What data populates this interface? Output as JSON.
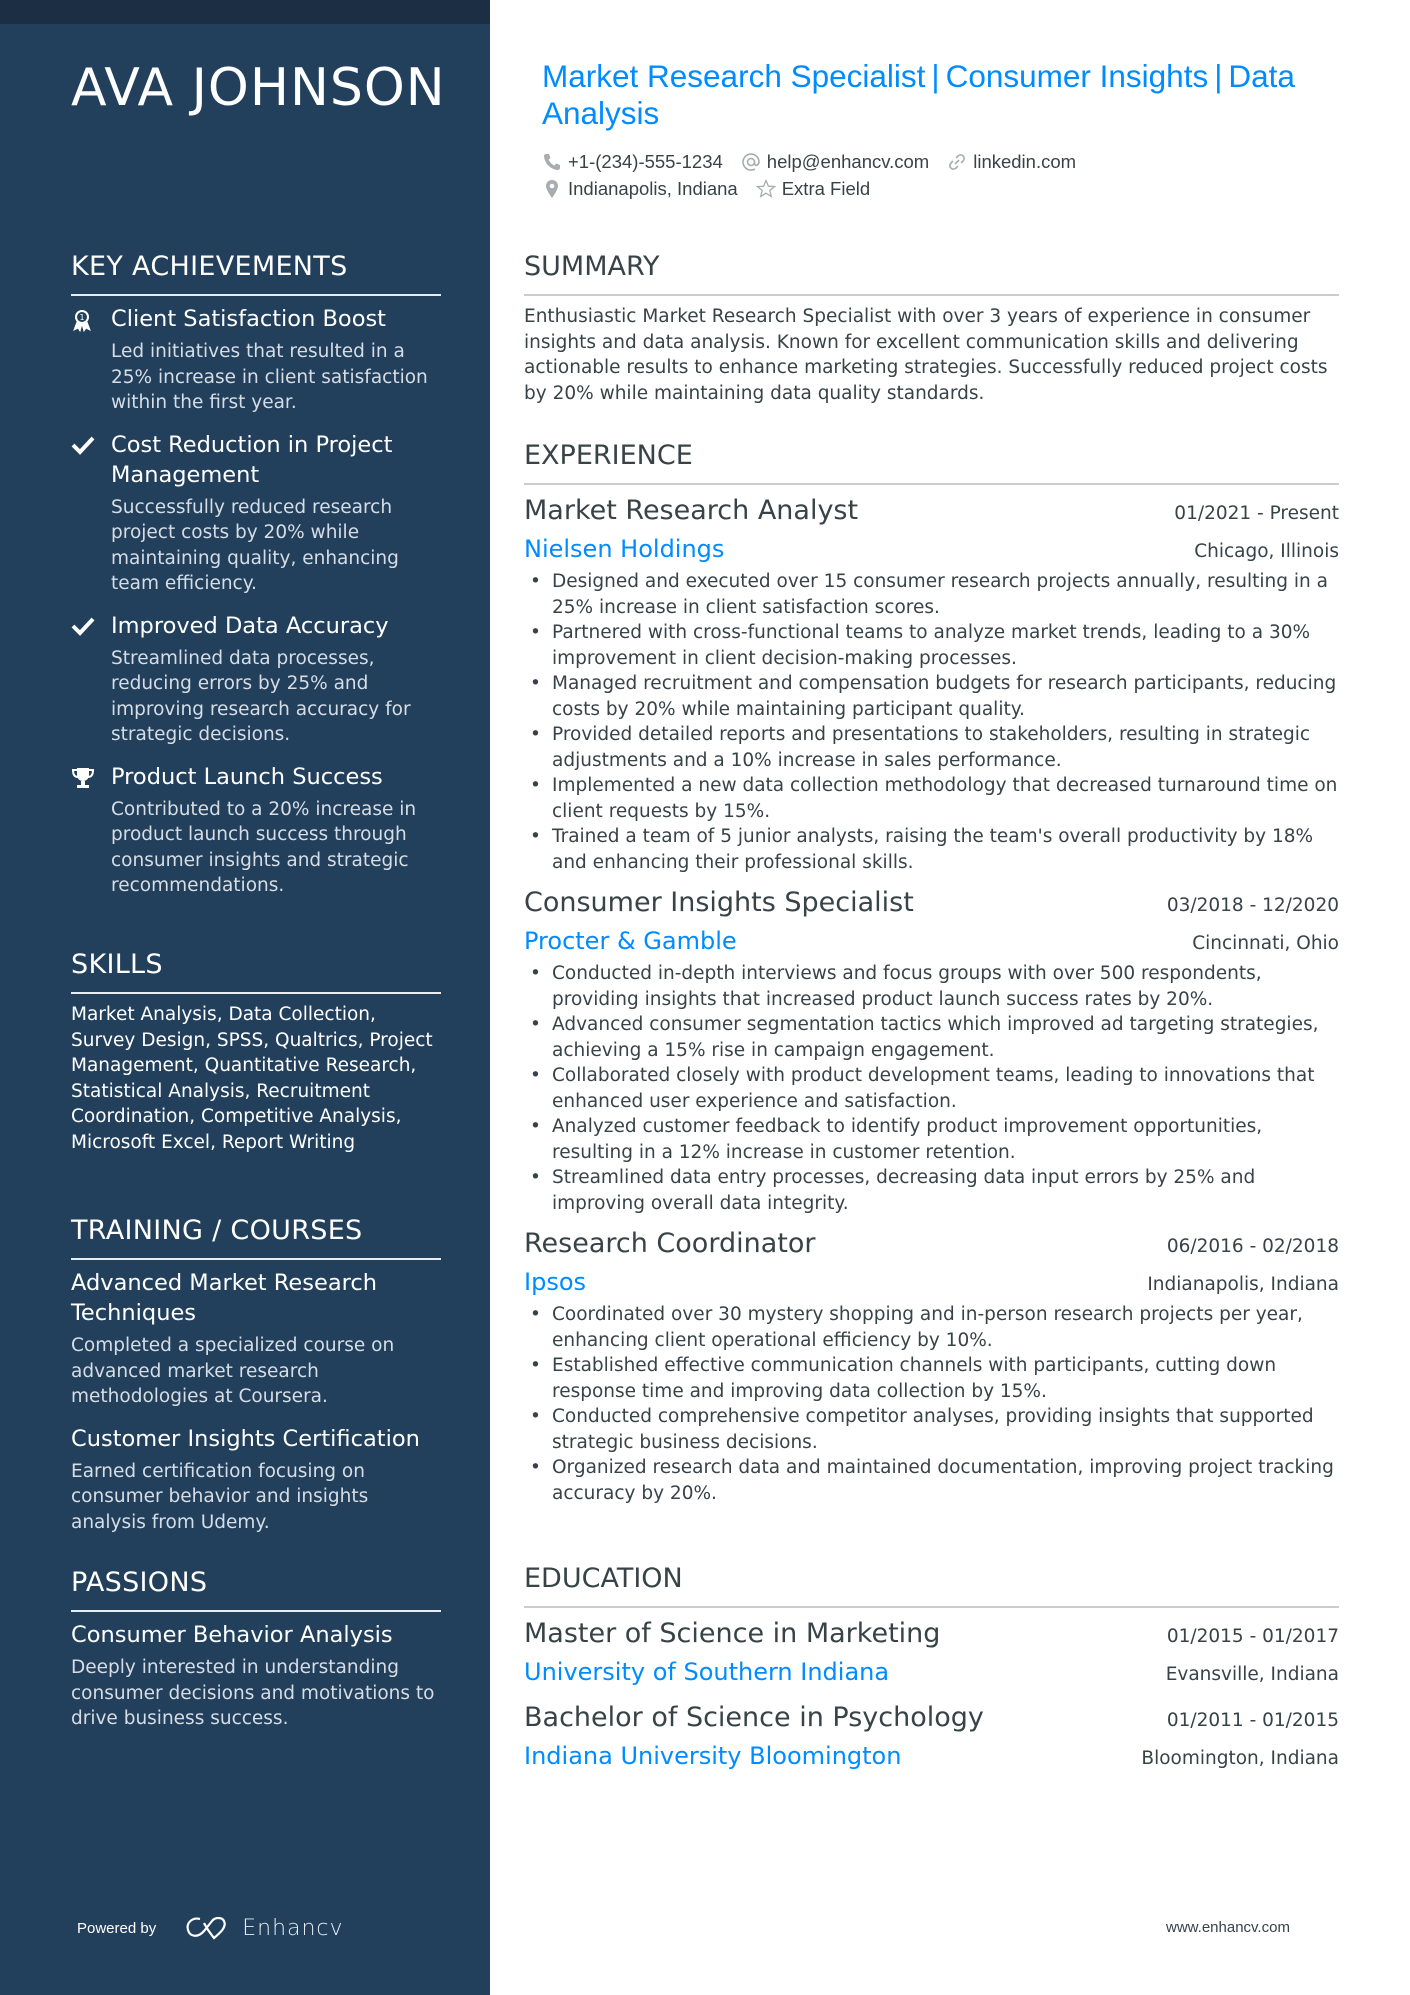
{
  "colors": {
    "sidebar": "#22405c",
    "accent": "#008cff",
    "text": "#384347"
  },
  "name": "AVA JOHNSON",
  "title_parts": [
    "Market Research Specialist",
    "Consumer Insights",
    "Data Analysis"
  ],
  "title_separator": "|",
  "contacts": {
    "phone": {
      "icon": "phone-icon",
      "value": "+1-(234)-555-1234"
    },
    "email": {
      "icon": "at-icon",
      "value": "help@enhancv.com"
    },
    "link": {
      "icon": "link-icon",
      "value": "linkedin.com"
    },
    "location": {
      "icon": "location-pin-icon",
      "value": "Indianapolis, Indiana"
    },
    "extra": {
      "icon": "star-icon",
      "value": "Extra Field"
    }
  },
  "sidebar": {
    "achievements": {
      "heading": "KEY ACHIEVEMENTS",
      "items": [
        {
          "icon": "medal-icon",
          "title": "Client Satisfaction Boost",
          "desc": "Led initiatives that resulted in a 25% increase in client satisfaction within the first year."
        },
        {
          "icon": "check-icon",
          "title": "Cost Reduction in Project Management",
          "desc": "Successfully reduced research project costs by 20% while maintaining quality, enhancing team efficiency."
        },
        {
          "icon": "check-icon",
          "title": "Improved Data Accuracy",
          "desc": "Streamlined data processes, reducing errors by 25% and improving research accuracy for strategic decisions."
        },
        {
          "icon": "trophy-icon",
          "title": "Product Launch Success",
          "desc": "Contributed to a 20% increase in product launch success through consumer insights and strategic recommendations."
        }
      ]
    },
    "skills": {
      "heading": "SKILLS",
      "text": "Market Analysis, Data Collection, Survey Design, SPSS, Qualtrics, Project Management, Quantitative Research, Statistical Analysis, Recruitment Coordination, Competitive Analysis, Microsoft Excel, Report Writing"
    },
    "training": {
      "heading": "TRAINING / COURSES",
      "items": [
        {
          "title": "Advanced Market Research Techniques",
          "desc": "Completed a specialized course on advanced market research methodologies at Coursera."
        },
        {
          "title": "Customer Insights Certification",
          "desc": "Earned certification focusing on consumer behavior and insights analysis from Udemy."
        }
      ]
    },
    "passions": {
      "heading": "PASSIONS",
      "items": [
        {
          "title": "Consumer Behavior Analysis",
          "desc": "Deeply interested in understanding consumer decisions and motivations to drive business success."
        }
      ]
    },
    "footer": {
      "powered_by": "Powered by",
      "brand": "Enhancv"
    }
  },
  "summary": {
    "heading": "SUMMARY",
    "text": "Enthusiastic Market Research Specialist with over 3 years of experience in consumer insights and data analysis. Known for excellent communication skills and delivering actionable results to enhance marketing strategies. Successfully reduced project costs by 20% while maintaining data quality standards."
  },
  "experience": {
    "heading": "EXPERIENCE",
    "jobs": [
      {
        "title": "Market Research Analyst",
        "dates": "01/2021 - Present",
        "company": "Nielsen Holdings",
        "location": "Chicago, Illinois",
        "bullets": [
          "Designed and executed over 15 consumer research projects annually, resulting in a 25% increase in client satisfaction scores.",
          "Partnered with cross-functional teams to analyze market trends, leading to a 30% improvement in client decision-making processes.",
          "Managed recruitment and compensation budgets for research participants, reducing costs by 20% while maintaining participant quality.",
          "Provided detailed reports and presentations to stakeholders, resulting in strategic adjustments and a 10% increase in sales performance.",
          "Implemented a new data collection methodology that decreased turnaround time on client requests by 15%.",
          "Trained a team of 5 junior analysts, raising the team's overall productivity by 18% and enhancing their professional skills."
        ]
      },
      {
        "title": "Consumer Insights Specialist",
        "dates": "03/2018 - 12/2020",
        "company": "Procter & Gamble",
        "location": "Cincinnati, Ohio",
        "bullets": [
          "Conducted in-depth interviews and focus groups with over 500 respondents, providing insights that increased product launch success rates by 20%.",
          "Advanced consumer segmentation tactics which improved ad targeting strategies, achieving a 15% rise in campaign engagement.",
          "Collaborated closely with product development teams, leading to innovations that enhanced user experience and satisfaction.",
          "Analyzed customer feedback to identify product improvement opportunities, resulting in a 12% increase in customer retention.",
          "Streamlined data entry processes, decreasing data input errors by 25% and improving overall data integrity."
        ]
      },
      {
        "title": "Research Coordinator",
        "dates": "06/2016 - 02/2018",
        "company": "Ipsos",
        "location": "Indianapolis, Indiana",
        "bullets": [
          "Coordinated over 30 mystery shopping and in-person research projects per year, enhancing client operational efficiency by 10%.",
          "Established effective communication channels with participants, cutting down response time and improving data collection by 15%.",
          "Conducted comprehensive competitor analyses, providing insights that supported strategic business decisions.",
          "Organized research data and maintained documentation, improving project tracking accuracy by 20%."
        ]
      }
    ]
  },
  "education": {
    "heading": "EDUCATION",
    "items": [
      {
        "degree": "Master of Science in Marketing",
        "dates": "01/2015 - 01/2017",
        "school": "University of Southern Indiana",
        "location": "Evansville, Indiana"
      },
      {
        "degree": "Bachelor of Science in Psychology",
        "dates": "01/2011 - 01/2015",
        "school": "Indiana University Bloomington",
        "location": "Bloomington, Indiana"
      }
    ]
  },
  "footer_url": "www.enhancv.com"
}
